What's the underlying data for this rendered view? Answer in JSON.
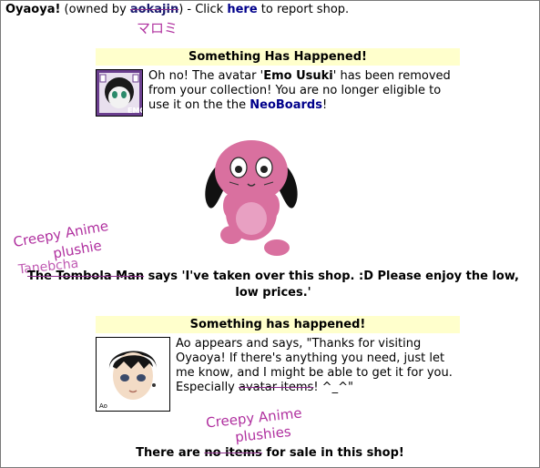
{
  "header": {
    "shop_name": "Oyaoya!",
    "owned_by_prefix": "(owned by ",
    "owner": "aokajin",
    "owned_by_suffix": ") - Click ",
    "here_link": "here",
    "report_suffix": " to report shop."
  },
  "handwriting": {
    "owner_note": "マロミ",
    "npc_line1": "Creepy Anime",
    "npc_line2": "plushie",
    "npc_scribble": "Tanebcha",
    "items_line1": "Creepy Anime",
    "items_line2": "plushies"
  },
  "notice1": {
    "title": "Something Has Happened!",
    "text_1": "Oh no! The avatar '",
    "avatar_name": "Emo Usuki",
    "text_2": "' has been removed from your collection! You are no longer eligible to use it on the the ",
    "neoboards_link": "NeoBoards",
    "text_3": "!",
    "badge": "EMO"
  },
  "npc": {
    "name": "The Tombola Man",
    "text": " says 'I've taken over this shop. :D Please enjoy the low, low prices.'"
  },
  "notice2": {
    "title": "Something has happened!",
    "text_1": "Ao appears and says, \"Thanks for visiting Oyaoya! If there's anything you need, just let me know, and I might be able to get it for you. Especially ",
    "struck": "avatar items",
    "text_2": "! ^_^\"",
    "signature": "Ao"
  },
  "footer": {
    "prefix": "There are ",
    "struck": "no items",
    "suffix": " for sale in this shop!"
  },
  "colors": {
    "notice_bg": "#ffffcc",
    "link": "#00008b",
    "plush_pink": "#d9709f",
    "scrawl": "#b0309f"
  }
}
